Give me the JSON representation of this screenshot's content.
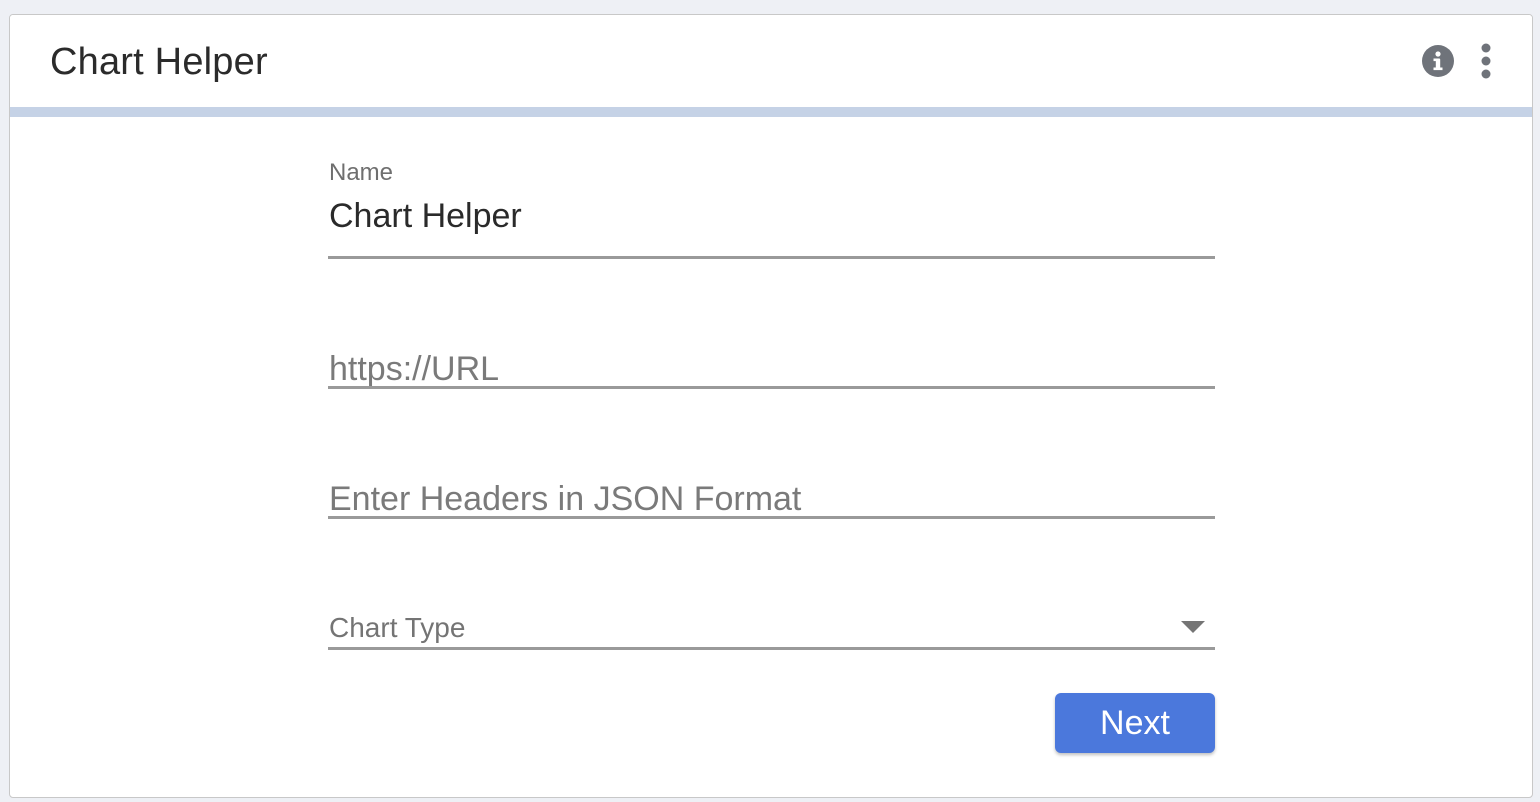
{
  "header": {
    "title": "Chart Helper",
    "info_icon": "info-icon",
    "more_icon": "more-vertical-icon"
  },
  "form": {
    "name": {
      "label": "Name",
      "value": "Chart Helper"
    },
    "url": {
      "placeholder": "https://URL",
      "value": ""
    },
    "headers": {
      "placeholder": "Enter Headers in JSON Format",
      "value": ""
    },
    "chart_type": {
      "label": "Chart Type",
      "selected": ""
    },
    "next_label": "Next"
  },
  "colors": {
    "accent": "#4b78dc",
    "header_bar": "#c5d2e6",
    "underline": "#9a9a9a"
  }
}
